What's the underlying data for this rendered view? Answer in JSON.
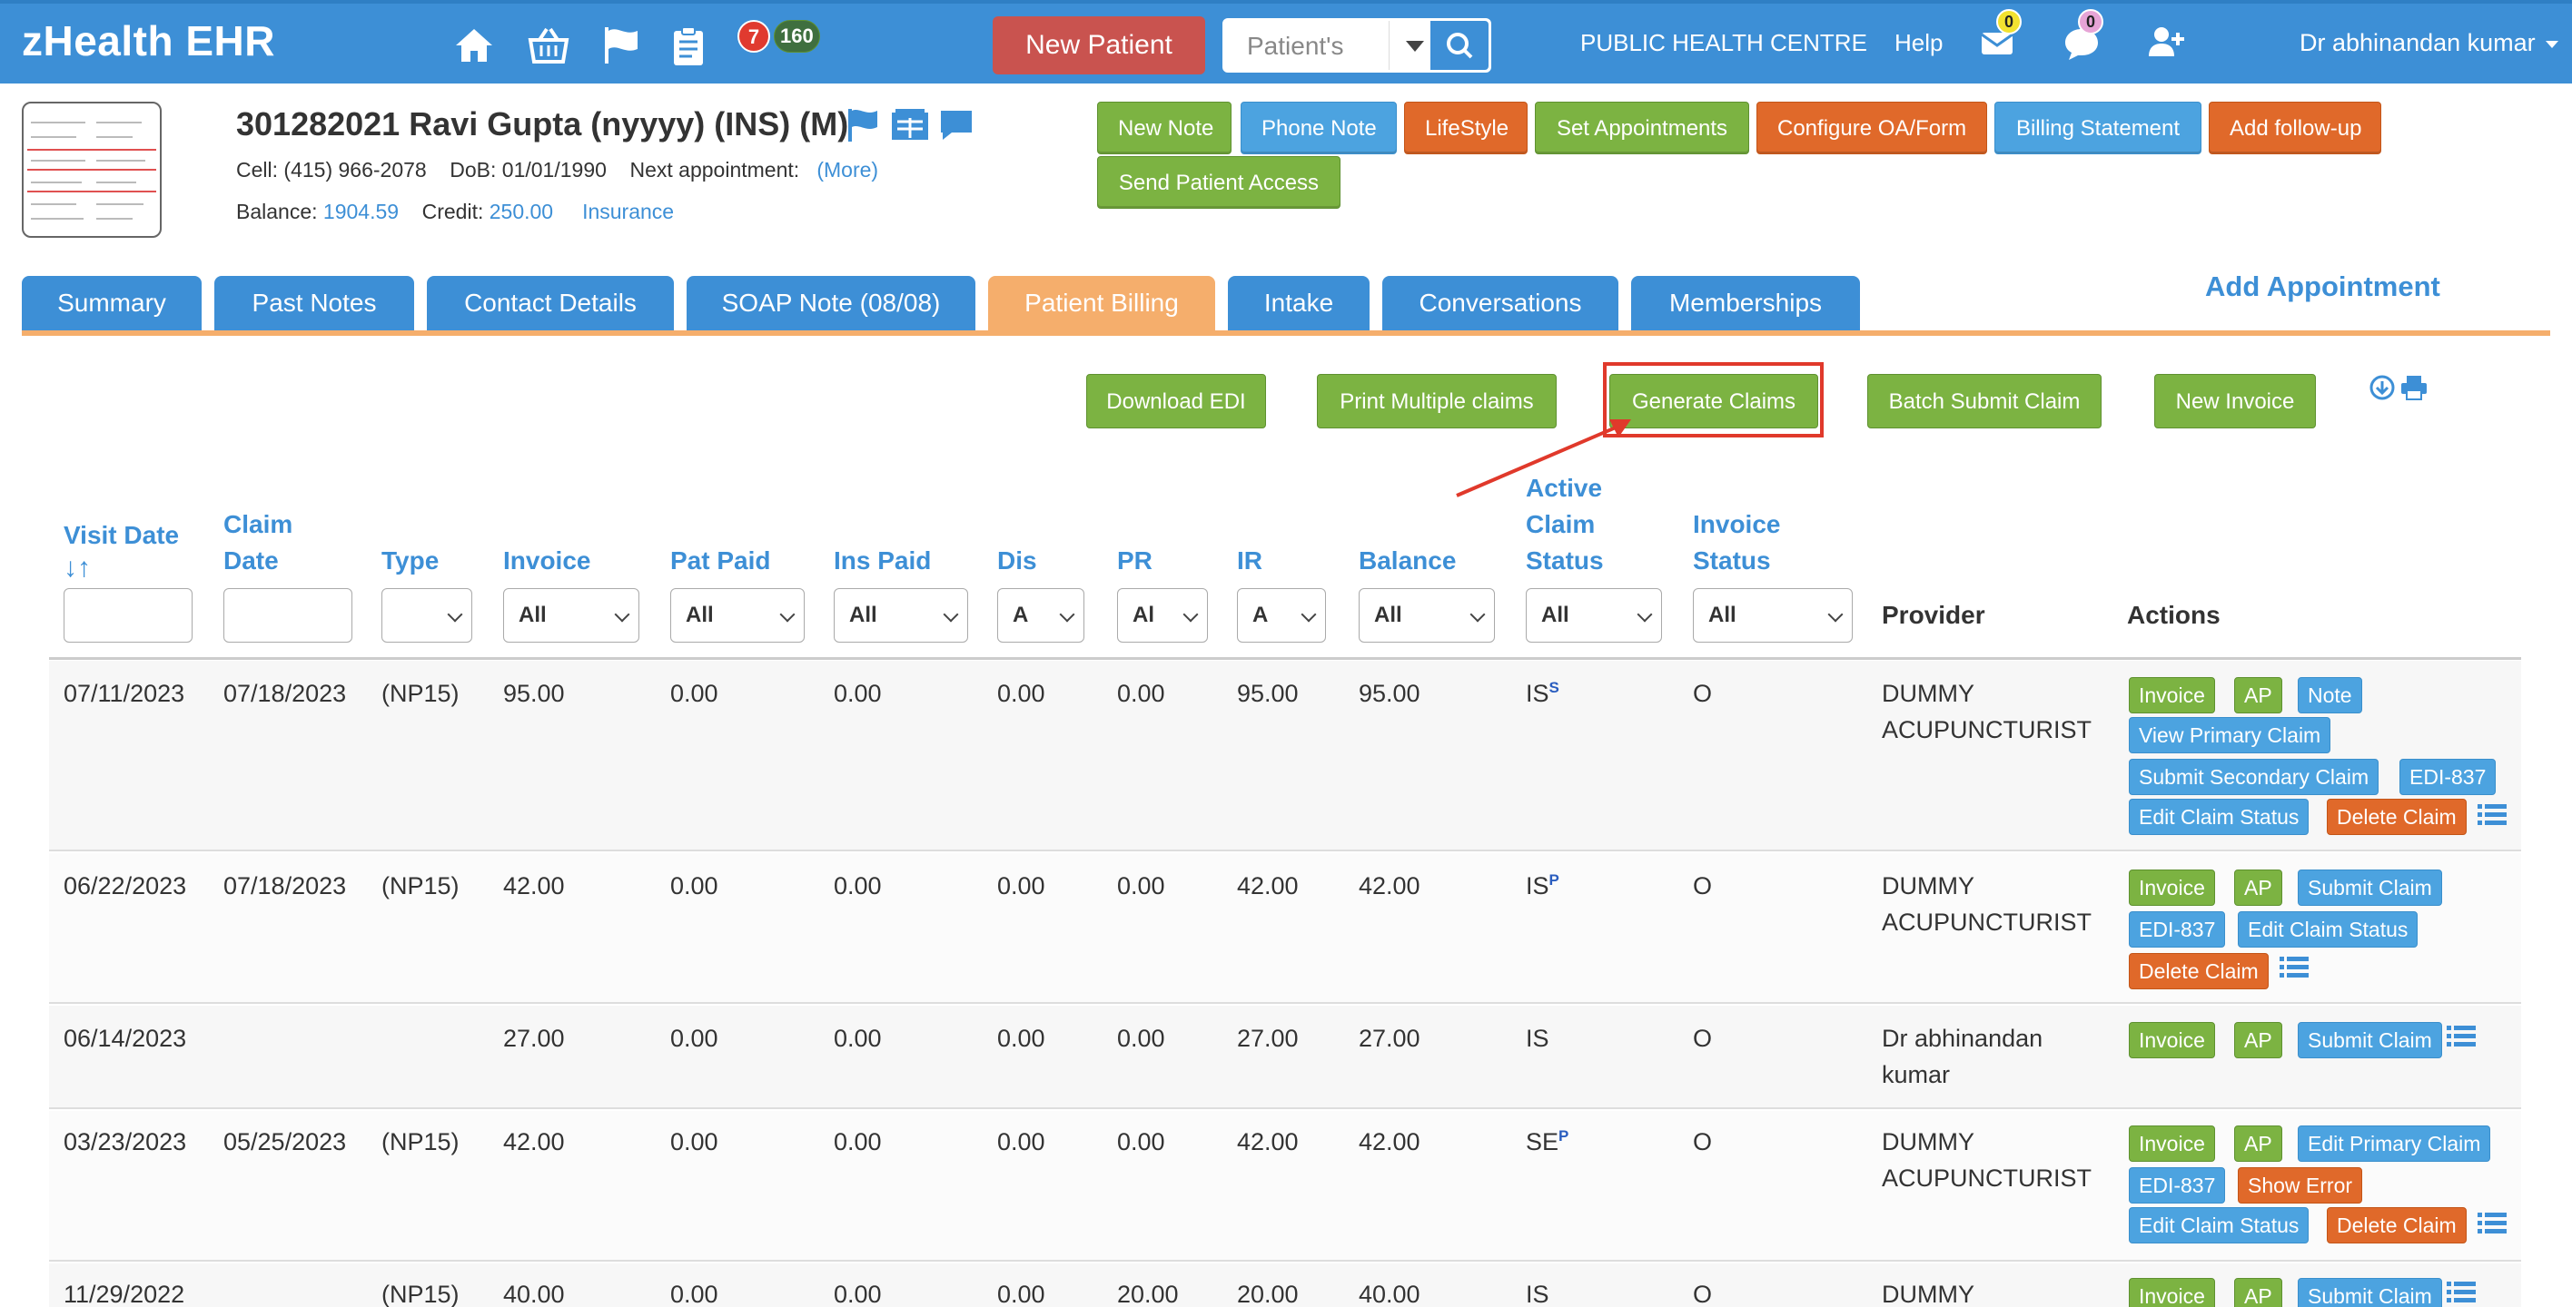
{
  "app": {
    "brand": "zHealth EHR"
  },
  "topnav": {
    "badge_tasks": "7",
    "badge_messages": "160",
    "new_patient": "New Patient",
    "search_placeholder": "Patient's",
    "clinic": "PUBLIC HEALTH CENTRE",
    "help": "Help",
    "mail_count": "0",
    "chat_count": "0",
    "user": "Dr abhinandan kumar"
  },
  "patient": {
    "title": "301282021 Ravi Gupta  (nyyyy) (INS) (M)",
    "cell_label": "Cell:",
    "cell": "(415) 966-2078",
    "dob_label": "DoB:",
    "dob": "01/01/1990",
    "next_appt_label": "Next appointment:",
    "more": "(More)",
    "balance_label": "Balance:",
    "balance": "1904.59",
    "credit_label": "Credit:",
    "credit": "250.00",
    "insurance": "Insurance"
  },
  "header_buttons": {
    "new_note": "New Note",
    "phone_note": "Phone Note",
    "lifestyle": "LifeStyle",
    "set_appointments": "Set Appointments",
    "configure": "Configure OA/Form",
    "billing_statement": "Billing Statement",
    "add_followup": "Add follow-up",
    "send_access": "Send Patient Access"
  },
  "tabs": [
    {
      "label": "Summary"
    },
    {
      "label": "Past Notes"
    },
    {
      "label": "Contact Details"
    },
    {
      "label": "SOAP Note (08/08)"
    },
    {
      "label": "Patient Billing"
    },
    {
      "label": "Intake"
    },
    {
      "label": "Conversations"
    },
    {
      "label": "Memberships"
    }
  ],
  "active_tab": "Patient Billing",
  "add_appointment": "Add Appointment",
  "billing_actions": {
    "download_edi": "Download EDI",
    "print_multiple": "Print Multiple claims",
    "generate_claims": "Generate Claims",
    "batch_submit": "Batch Submit Claim",
    "new_invoice": "New Invoice"
  },
  "columns": {
    "visit_date": "Visit Date",
    "sort_glyph": "↓↑",
    "claim_date_1": "Claim",
    "claim_date_2": "Date",
    "type": "Type",
    "invoice": "Invoice",
    "pat_paid": "Pat Paid",
    "ins_paid": "Ins Paid",
    "dis": "Dis",
    "pr": "PR",
    "ir": "IR",
    "balance": "Balance",
    "active_1": "Active",
    "active_2": "Claim",
    "active_3": "Status",
    "inv_status_1": "Invoice",
    "inv_status_2": "Status",
    "provider": "Provider",
    "actions": "Actions"
  },
  "filters": {
    "invoice": "All",
    "pat_paid": "All",
    "ins_paid": "All",
    "dis": "A",
    "pr": "Al",
    "ir": "A",
    "balance": "All",
    "active": "All",
    "inv_status": "All"
  },
  "rows": [
    {
      "visit": "07/11/2023",
      "claim": "07/18/2023",
      "type": "(NP15)",
      "invoice": "95.00",
      "pat_paid": "0.00",
      "ins_paid": "0.00",
      "dis": "0.00",
      "pr": "0.00",
      "ir": "95.00",
      "balance": "95.00",
      "status": "IS",
      "status_sup": "S",
      "inv_status": "O",
      "provider_1": "DUMMY",
      "provider_2": "ACUPUNCTURIST"
    },
    {
      "visit": "06/22/2023",
      "claim": "07/18/2023",
      "type": "(NP15)",
      "invoice": "42.00",
      "pat_paid": "0.00",
      "ins_paid": "0.00",
      "dis": "0.00",
      "pr": "0.00",
      "ir": "42.00",
      "balance": "42.00",
      "status": "IS",
      "status_sup": "P",
      "inv_status": "O",
      "provider_1": "DUMMY",
      "provider_2": "ACUPUNCTURIST"
    },
    {
      "visit": "06/14/2023",
      "claim": "",
      "type": "",
      "invoice": "27.00",
      "pat_paid": "0.00",
      "ins_paid": "0.00",
      "dis": "0.00",
      "pr": "0.00",
      "ir": "27.00",
      "balance": "27.00",
      "status": "IS",
      "status_sup": "",
      "inv_status": "O",
      "provider_1": "Dr abhinandan",
      "provider_2": "kumar"
    },
    {
      "visit": "03/23/2023",
      "claim": "05/25/2023",
      "type": "(NP15)",
      "invoice": "42.00",
      "pat_paid": "0.00",
      "ins_paid": "0.00",
      "dis": "0.00",
      "pr": "0.00",
      "ir": "42.00",
      "balance": "42.00",
      "status": "SE",
      "status_sup": "P",
      "inv_status": "O",
      "provider_1": "DUMMY",
      "provider_2": "ACUPUNCTURIST"
    },
    {
      "visit": "11/29/2022",
      "claim": "",
      "type": "(NP15)",
      "invoice": "40.00",
      "pat_paid": "0.00",
      "ins_paid": "0.00",
      "dis": "0.00",
      "pr": "20.00",
      "ir": "20.00",
      "balance": "40.00",
      "status": "IS",
      "status_sup": "",
      "inv_status": "O",
      "provider_1": "DUMMY",
      "provider_2": ""
    }
  ],
  "row_actions": {
    "invoice": "Invoice",
    "ap": "AP",
    "note": "Note",
    "view_primary": "View Primary Claim",
    "submit_secondary": "Submit Secondary Claim",
    "edi837": "EDI-837",
    "edit_status": "Edit Claim Status",
    "delete_claim": "Delete Claim",
    "submit_claim": "Submit Claim",
    "edit_primary": "Edit Primary Claim",
    "show_error": "Show Error"
  }
}
